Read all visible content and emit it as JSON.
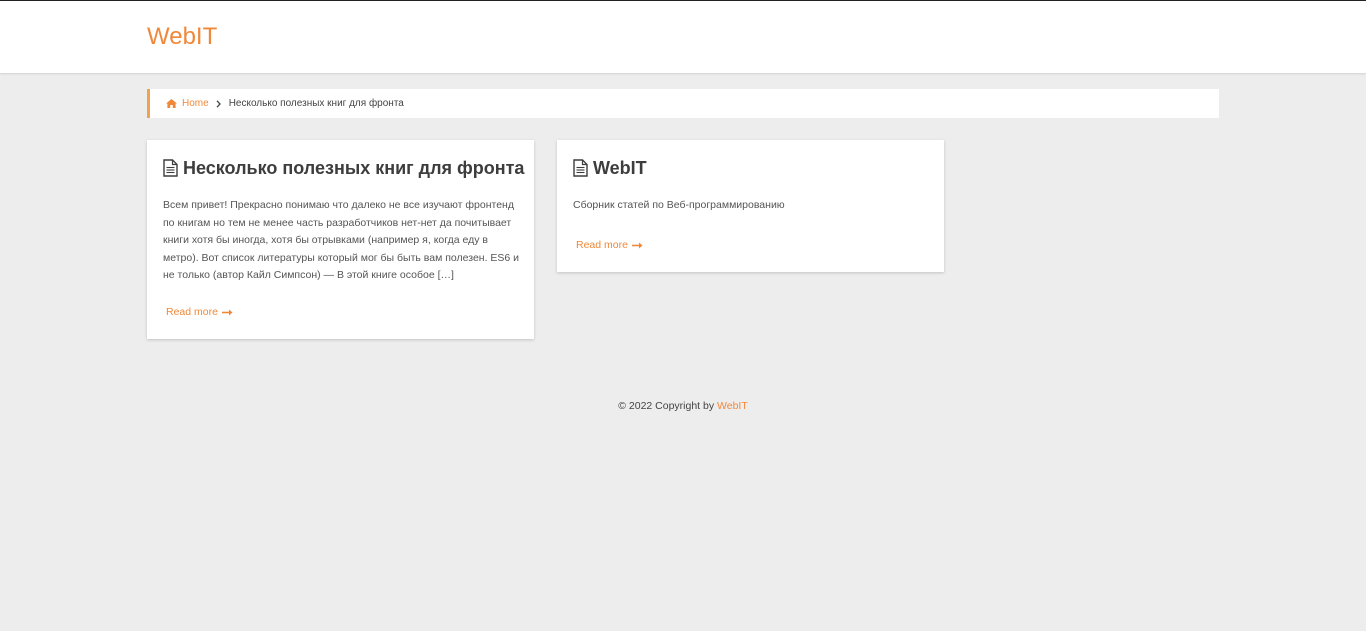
{
  "header": {
    "logo": "WebIT"
  },
  "breadcrumb": {
    "home_label": "Home",
    "current": "Несколько полезных книг для фронта"
  },
  "posts": [
    {
      "title": "Несколько полезных книг для фронта",
      "excerpt": "Всем привет! Прекрасно понимаю что далеко не все изучают фронтенд по книгам но тем не менее часть разработчиков нет-нет да почитывает книги хотя бы иногда, хотя бы отрывками (например я, когда еду в метро). Вот список литературы который мог бы быть вам полезен. ES6 и не только (автор Кайл Симпсон) — В этой книге особое […]",
      "read_more": "Read more"
    },
    {
      "title": "WebIT",
      "excerpt": "Сборник статей по Веб-программированию",
      "read_more": "Read more"
    }
  ],
  "footer": {
    "copyright": "© 2022 Copyright by",
    "brand": "WebIT"
  },
  "colors": {
    "accent": "#f0883a",
    "background": "#ededed",
    "card": "#ffffff"
  }
}
